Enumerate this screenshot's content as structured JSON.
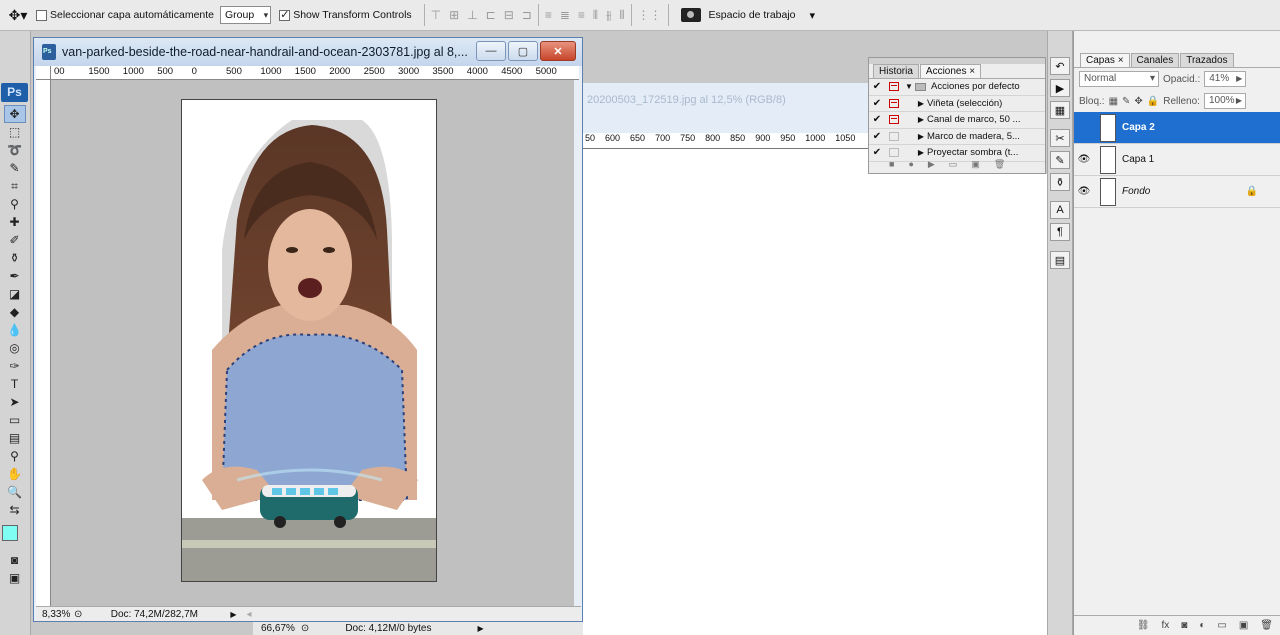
{
  "options_bar": {
    "auto_select_label": "Seleccionar capa automáticamente",
    "auto_select_value": "Group",
    "show_transform_label": "Show Transform Controls",
    "workspace_label": "Espacio de trabajo"
  },
  "app_logo": "Ps",
  "document": {
    "title": "van-parked-beside-the-road-near-handrail-and-ocean-2303781.jpg al 8,...",
    "ruler_ticks": [
      "00",
      "1500",
      "1000",
      "500",
      "0",
      "500",
      "1000",
      "1500",
      "2000",
      "2500",
      "3000",
      "3500",
      "4000",
      "4500",
      "5000"
    ],
    "zoom": "8,33%",
    "doc_info": "Doc: 74,2M/282,7M"
  },
  "background_document": {
    "title": "20200503_172519.jpg al 12,5% (RGB/8)",
    "ruler_ticks": [
      "50",
      "600",
      "650",
      "700",
      "750",
      "800",
      "850",
      "900",
      "950",
      "1000",
      "1050"
    ],
    "zoom": "66,67%",
    "doc_info": "Doc: 4,12M/0 bytes"
  },
  "actions_panel": {
    "tab_history": "Historia",
    "tab_actions": "Acciones",
    "rows": [
      {
        "label": "Acciones por defecto",
        "type": "set",
        "dialog": true
      },
      {
        "label": "Viñeta (selección)",
        "type": "action",
        "dialog": true
      },
      {
        "label": "Canal de marco, 50 ...",
        "type": "action",
        "dialog": true
      },
      {
        "label": "Marco de madera, 5...",
        "type": "action",
        "dialog": false
      },
      {
        "label": "Proyectar sombra (t...",
        "type": "action",
        "dialog": false
      }
    ]
  },
  "layers_panel": {
    "tab_layers": "Capas",
    "tab_channels": "Canales",
    "tab_paths": "Trazados",
    "blend_mode": "Normal",
    "opacity_label": "Opacid.:",
    "opacity_value": "41%",
    "lock_label": "Bloq.:",
    "fill_label": "Relleno:",
    "fill_value": "100%",
    "layers": [
      {
        "name": "Capa 2",
        "selected": true,
        "visible": false
      },
      {
        "name": "Capa 1",
        "selected": false,
        "visible": true
      },
      {
        "name": "Fondo",
        "selected": false,
        "visible": true,
        "locked": true
      }
    ]
  },
  "colors": {
    "foreground": "#7ffff3",
    "background": "#ffffff",
    "selection": "#1e6fd0"
  }
}
